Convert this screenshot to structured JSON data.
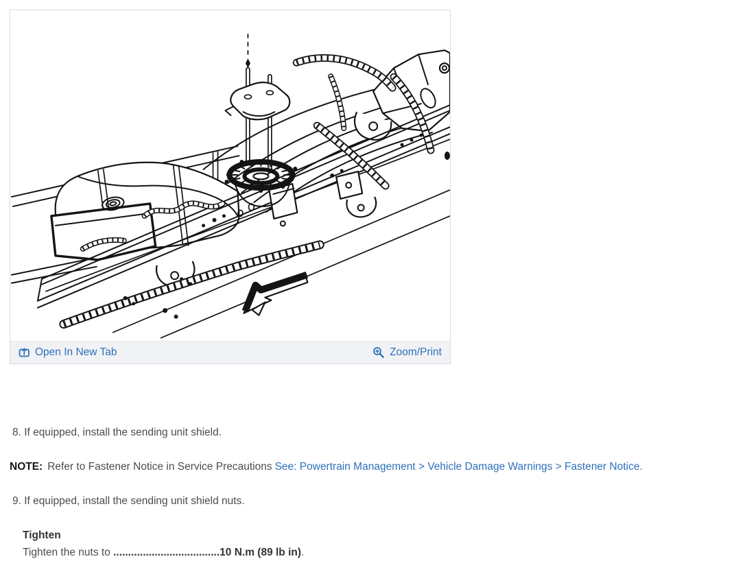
{
  "colors": {
    "link_blue": "#2e70ba",
    "toolbar_bg": "#f1f2f6",
    "panel_border": "#d9dbdf",
    "body_text": "#4c4c4c",
    "line_art": "#141414"
  },
  "image_panel": {
    "description": "Isometric line drawing of truck frame rail with fuel tank, corrugated fuel hoses, sending unit lock ring, shield bracket with two mounting studs, and a black 3D arrow pointing to the lower left",
    "icons": {
      "open_in_new_tab": "box-with-up-arrow",
      "zoom_print": "magnifier-plus"
    },
    "footer": {
      "open_in_new_tab": "Open In New Tab",
      "zoom_print": "Zoom/Print"
    }
  },
  "steps": {
    "step8": "8. If equipped, install the sending unit shield.",
    "note_label": "NOTE:",
    "note_text": "Refer to Fastener Notice in Service Precautions",
    "note_link": "See: Powertrain Management > Vehicle Damage Warnings > Fastener Notice.",
    "step9": "9. If equipped, install the sending unit shield nuts.",
    "tighten_label": "Tighten",
    "tighten_prefix": "Tighten the nuts to ",
    "tighten_dots": "....................................",
    "tighten_value": "10 N.m (89 lb in)",
    "tighten_suffix": "."
  }
}
